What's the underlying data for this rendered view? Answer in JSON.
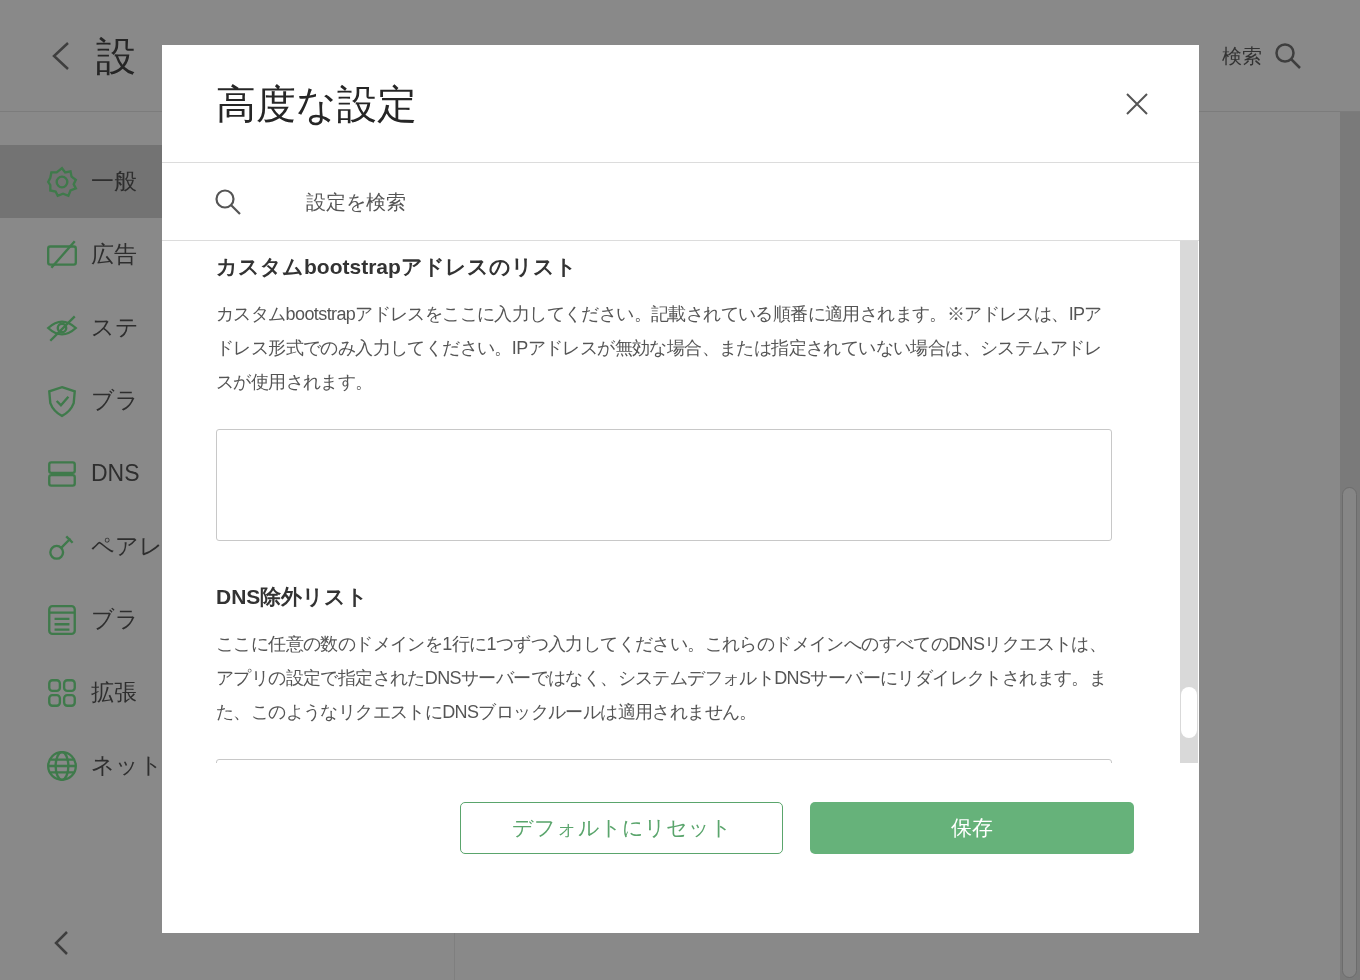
{
  "page": {
    "title": "設",
    "search_label": "検索",
    "sidebar": [
      {
        "label": "一般",
        "selected": true
      },
      {
        "label": "広告",
        "selected": false
      },
      {
        "label": "ステ",
        "selected": false
      },
      {
        "label": "ブラ",
        "selected": false
      },
      {
        "label": "DNS",
        "selected": false
      },
      {
        "label": "ペアレ",
        "selected": false
      },
      {
        "label": "ブラ",
        "selected": false
      },
      {
        "label": "拡張",
        "selected": false
      },
      {
        "label": "ネット",
        "selected": false
      }
    ]
  },
  "dialog": {
    "title": "高度な設定",
    "search": {
      "placeholder": "設定を検索"
    },
    "sections": [
      {
        "heading": "カスタムbootstrapアドレスのリスト",
        "description": "カスタムbootstrapアドレスをここに入力してください。記載されている順番に適用されます。※アドレスは、IPアドレス形式でのみ入力してください。IPアドレスが無効な場合、または指定されていない場合は、システムアドレスが使用されます。"
      },
      {
        "heading": "DNS除外リスト",
        "description": "ここに任意の数のドメインを1行に1つずつ入力してください。これらのドメインへのすべてのDNSリクエストは、アプリの設定で指定されたDNSサーバーではなく、システムデフォルトDNSサーバーにリダイレクトされます。また、このようなリクエストにDNSブロックルールは適用されません。"
      }
    ],
    "buttons": [
      {
        "label": "デフォルトにリセット",
        "kind": "outline"
      },
      {
        "label": "保存",
        "kind": "primary"
      }
    ]
  }
}
